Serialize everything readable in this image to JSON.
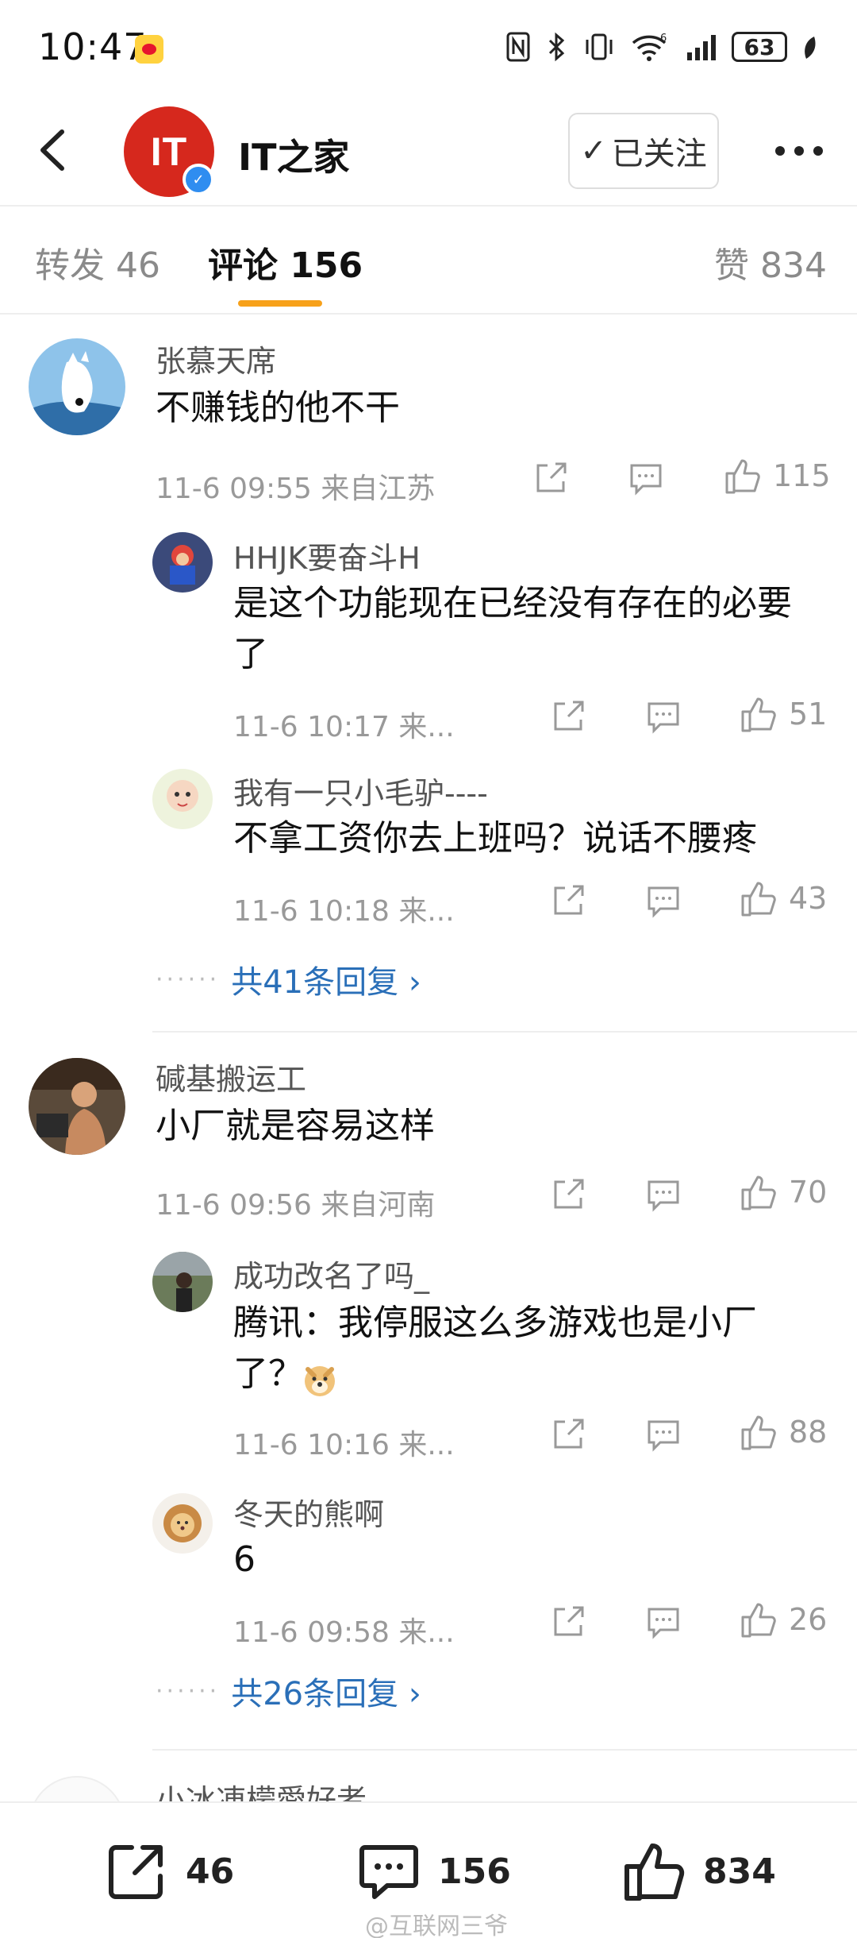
{
  "status_bar": {
    "time": "10:47",
    "battery": "63",
    "icons": [
      "nfc-icon",
      "bluetooth-icon",
      "vibrate-icon",
      "wifi-6-icon",
      "signal-icon",
      "battery-icon",
      "leaf-icon"
    ]
  },
  "header": {
    "account_name": "IT之家",
    "avatar_logo": "IT",
    "follow_label": "已关注",
    "follow_check": "✓"
  },
  "tabs": [
    {
      "label": "转发 46"
    },
    {
      "label": "评论 156"
    },
    {
      "label": "赞 834"
    }
  ],
  "comments": [
    {
      "name": "张慕天席",
      "text": "不赚钱的他不干",
      "meta": "11-6 09:55  来自江苏",
      "likes": "115",
      "replies": [
        {
          "name": "HHJK要奋斗H",
          "text": "是这个功能现在已经没有存在的必要了",
          "meta": "11-6 10:17  来...",
          "likes": "51"
        },
        {
          "name": "我有一只小毛驴----",
          "text": "不拿工资你去上班吗？说话不腰疼",
          "meta": "11-6 10:18  来...",
          "likes": "43"
        }
      ],
      "more": "共41条回复 ›",
      "dots": "······"
    },
    {
      "name": "碱基搬运工",
      "text": "小厂就是容易这样",
      "meta": "11-6 09:56  来自河南",
      "likes": "70",
      "replies": [
        {
          "name": "成功改名了吗_",
          "text": "腾讯：我停服这么多游戏也是小厂了？",
          "meta": "11-6 10:16  来...",
          "likes": "88"
        },
        {
          "name": "冬天的熊啊",
          "text": "6",
          "meta": "11-6 09:58  来...",
          "likes": "26"
        }
      ],
      "more": "共26条回复 ›",
      "dots": "······"
    },
    {
      "name": "小冰凍檬愛好者",
      "text": "",
      "meta": "",
      "likes": ""
    }
  ],
  "bottom_bar": {
    "repost_count": "46",
    "comment_count": "156",
    "like_count": "834",
    "watermark": "@互联网三爷"
  },
  "colors": {
    "accent_underline": "#f7a11a",
    "link_blue": "#2a6fb8",
    "brand_red": "#d6281d",
    "verify_blue": "#2f8df0"
  }
}
